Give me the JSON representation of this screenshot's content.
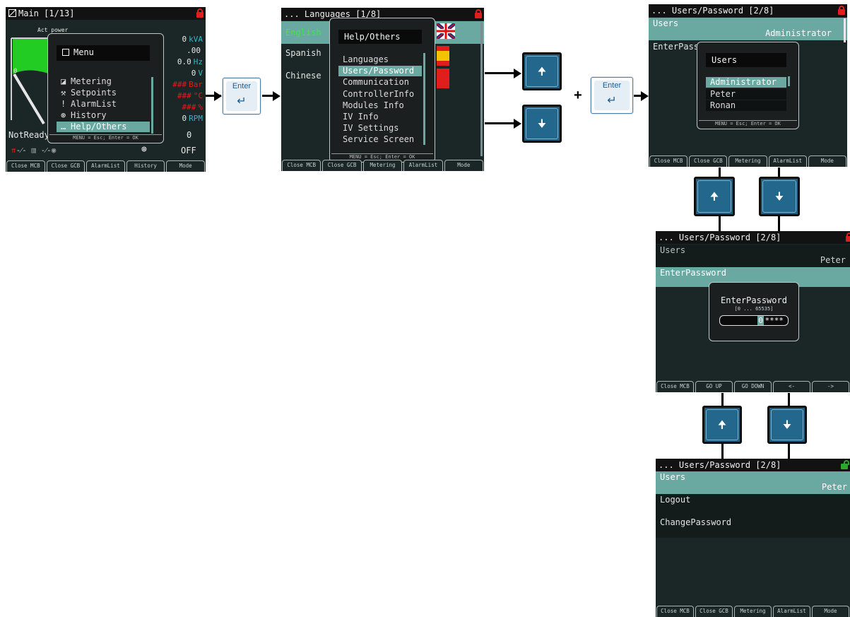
{
  "screen1": {
    "title": "Main [1/13]",
    "gauge_label": "Act power",
    "gauge_zero": "0",
    "readings": [
      {
        "value": "0",
        "unit": "kVA",
        "warn": false
      },
      {
        "value": ".00",
        "unit": "",
        "warn": false
      },
      {
        "value": "0.0",
        "unit": "Hz",
        "warn": false
      },
      {
        "value": "0",
        "unit": "V",
        "warn": false
      },
      {
        "value": "###",
        "unit": "Bar",
        "warn": true
      },
      {
        "value": "###",
        "unit": "°C",
        "warn": true
      },
      {
        "value": "###",
        "unit": "%",
        "warn": true
      },
      {
        "value": "0",
        "unit": "RPM",
        "warn": false
      }
    ],
    "status": "NotReady",
    "status_value": "0",
    "mode": "OFF",
    "menu": {
      "title": "Menu",
      "items": [
        "Metering",
        "Setpoints",
        "AlarmList",
        "History",
        "Help/Others"
      ],
      "selected": 4,
      "footer": "MENU = Esc; Enter = OK"
    },
    "softkeys": [
      "Close MCB",
      "Close GCB",
      "AlarmList",
      "History",
      "Mode"
    ]
  },
  "screen2": {
    "title": "... Languages [1/8]",
    "languages": [
      "English",
      "Spanish",
      "Chinese"
    ],
    "popup": {
      "title": "Help/Others",
      "items": [
        "Languages",
        "Users/Password",
        "Communication",
        "ControllerInfo",
        "Modules Info",
        "IV Info",
        "IV Settings",
        "Service Screen"
      ],
      "selected": 1,
      "footer": "MENU = Esc; Enter = OK"
    },
    "softkeys": [
      "Close MCB",
      "Close GCB",
      "Metering",
      "AlarmList",
      "Mode"
    ]
  },
  "keys": {
    "enter_label": "Enter",
    "plus": "+"
  },
  "screen3": {
    "title": "... Users/Password [2/8]",
    "row1_label": "Users",
    "row1_value": "Administrator",
    "row2_label": "EnterPass",
    "popup": {
      "title": "Users",
      "items": [
        "Administrator",
        "Peter",
        "Ronan"
      ],
      "selected": 0,
      "footer": "MENU = Esc; Enter = OK"
    },
    "softkeys": [
      "Close MCB",
      "Close GCB",
      "Metering",
      "AlarmList",
      "Mode"
    ]
  },
  "screen4": {
    "title": "... Users/Password [2/8]",
    "row1_label": "Users",
    "row1_value": "Peter",
    "row2_label": "EnterPassword",
    "popup": {
      "title": "EnterPassword",
      "range": "[0 ... 65535]",
      "cursor": "0",
      "value": "****"
    },
    "softkeys": [
      "Close MCB",
      "GO UP",
      "GO DOWN",
      "<-",
      "->"
    ]
  },
  "screen5": {
    "title": "... Users/Password [2/8]",
    "row1_label": "Users",
    "row1_value": "Peter",
    "row2_label": "Logout",
    "row3_label": "ChangePassword",
    "softkeys": [
      "Close MCB",
      "Close GCB",
      "Metering",
      "AlarmList",
      "Mode"
    ]
  },
  "colors": {
    "screen_bg": "#1b2626",
    "highlight": "#6aa9a1",
    "lock_locked": "#e01e1e",
    "lock_unlocked": "#2ca82c",
    "key_blue": "#1f5f82"
  }
}
